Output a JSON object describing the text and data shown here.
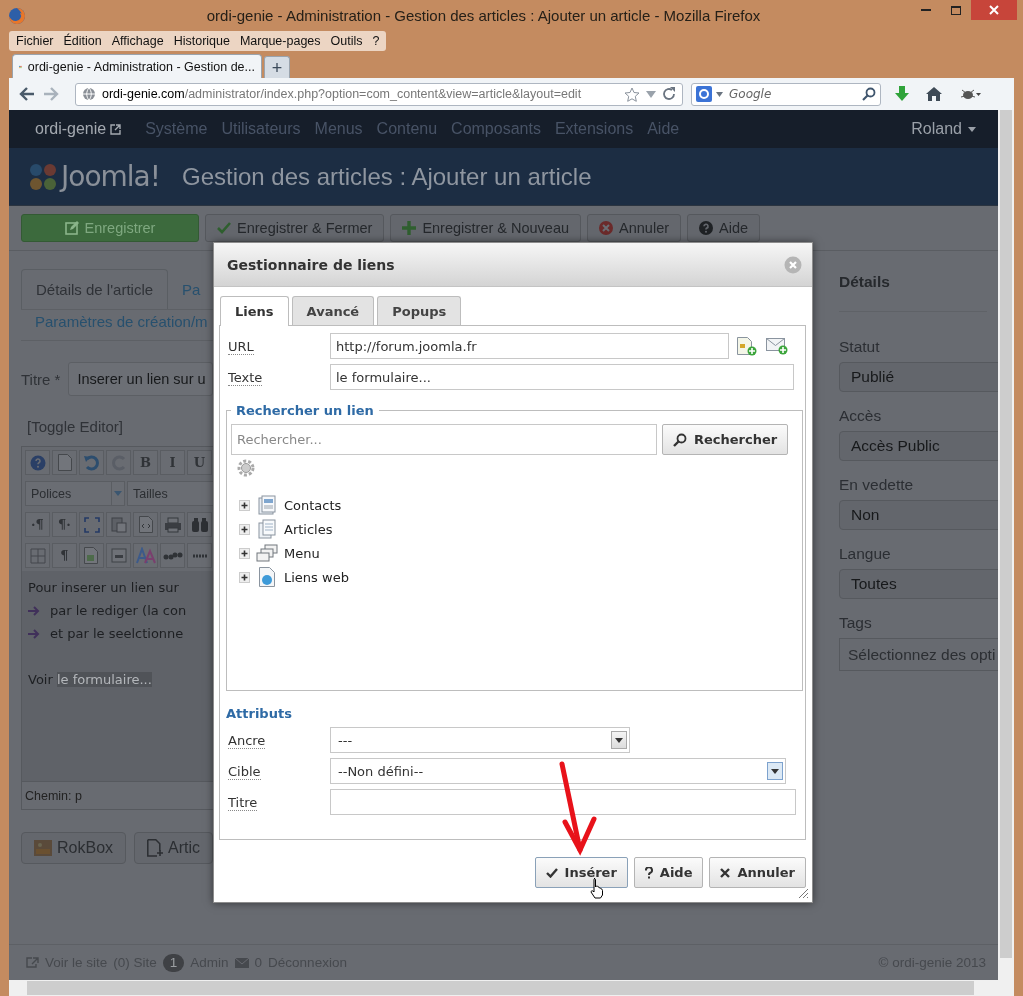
{
  "window": {
    "title": "ordi-genie - Administration - Gestion des articles : Ajouter un article - Mozilla Firefox"
  },
  "menu_bar": [
    "Fichier",
    "Édition",
    "Affichage",
    "Historique",
    "Marque-pages",
    "Outils",
    "?"
  ],
  "browser_tabs": [
    {
      "label": "ordi-genie - Administration - Gestion de...",
      "selected": true
    }
  ],
  "new_tab_button": "+",
  "address_bar": {
    "domain": "ordi-genie.com",
    "path": "/administrator/index.php?option=com_content&view=article&layout=edit"
  },
  "search_box": {
    "placeholder": "Google"
  },
  "admin_nav": {
    "site": "ordi-genie",
    "items": [
      "Système",
      "Utilisateurs",
      "Menus",
      "Contenu",
      "Composants",
      "Extensions",
      "Aide"
    ],
    "user": "Roland"
  },
  "header": {
    "logo_text": "Joomla!",
    "title": "Gestion des articles : Ajouter un article"
  },
  "toolbar": [
    {
      "label": "Enregistrer",
      "kind": "save"
    },
    {
      "label": "Enregistrer & Fermer",
      "kind": "save-close"
    },
    {
      "label": "Enregistrer & Nouveau",
      "kind": "save-new"
    },
    {
      "label": "Annuler",
      "kind": "cancel"
    },
    {
      "label": "Aide",
      "kind": "help"
    }
  ],
  "article_tabs": [
    {
      "label": "Détails de l'article",
      "selected": true
    },
    {
      "label": "Pa",
      "selected": false
    },
    {
      "label": "Paramètres de création/m",
      "selected": false
    }
  ],
  "title_field": {
    "label": "Titre *",
    "value": "Inserer un lien sur u"
  },
  "toggle_editor": "[Toggle Editor]",
  "editor": {
    "toolbar_rows": [
      [
        {
          "kind": "help"
        },
        {
          "kind": "document"
        },
        {
          "kind": "undo"
        },
        {
          "kind": "redo"
        },
        {
          "kind": "text",
          "label": "B"
        },
        {
          "kind": "text",
          "label": "I"
        },
        {
          "kind": "text",
          "label": "U"
        }
      ],
      [
        {
          "kind": "select",
          "label": "Polices"
        },
        {
          "kind": "select",
          "label": "Tailles"
        }
      ],
      [
        {
          "kind": "text",
          "label": "·¶"
        },
        {
          "kind": "text",
          "label": "¶·"
        },
        {
          "kind": "fullscreen"
        },
        {
          "kind": "paste"
        },
        {
          "kind": "code"
        },
        {
          "kind": "print"
        },
        {
          "kind": "binoculars"
        }
      ],
      [
        {
          "kind": "table"
        },
        {
          "kind": "text",
          "label": "¶"
        },
        {
          "kind": "image"
        },
        {
          "kind": "media"
        },
        {
          "kind": "font"
        },
        {
          "kind": "quote"
        },
        {
          "kind": "abbr"
        }
      ]
    ],
    "intro": "Pour inserer un lien sur",
    "bullets": [
      "par le rediger (la con",
      "et par le seelctionne"
    ],
    "link_prefix": "Voir",
    "selected_text": "le formulaire...",
    "path": "Chemin:  p"
  },
  "bottom_buttons": [
    {
      "label": "RokBox",
      "kind": "image"
    },
    {
      "label": "Artic",
      "kind": "article"
    }
  ],
  "details": {
    "title": "Détails",
    "fields": [
      {
        "label": "Statut",
        "value": "Publié"
      },
      {
        "label": "Accès",
        "value": "Accès Public"
      },
      {
        "label": "En vedette",
        "value": "Non"
      },
      {
        "label": "Langue",
        "value": "Toutes"
      },
      {
        "label": "Tags",
        "placeholder": "Sélectionnez des opti"
      }
    ]
  },
  "footer": {
    "items": [
      {
        "kind": "external",
        "label": "Voir le site"
      },
      {
        "kind": "text",
        "label": "(0) Site"
      },
      {
        "kind": "badge",
        "label": "1"
      },
      {
        "kind": "text",
        "label": "Admin"
      },
      {
        "kind": "mail",
        "label": "0"
      },
      {
        "kind": "text",
        "label": "Déconnexion"
      }
    ],
    "copyright": "© ordi-genie 2013"
  },
  "dialog": {
    "title": "Gestionnaire de liens",
    "tabs": [
      {
        "label": "Liens",
        "selected": true
      },
      {
        "label": "Avancé",
        "selected": false
      },
      {
        "label": "Popups",
        "selected": false
      }
    ],
    "url": {
      "label": "URL",
      "value": "http://forum.joomla.fr"
    },
    "text": {
      "label": "Texte",
      "value": "le formulaire..."
    },
    "search": {
      "legend": "Rechercher un lien",
      "placeholder": "Rechercher...",
      "button": "Rechercher"
    },
    "tree": [
      {
        "label": "Contacts",
        "kind": "contacts",
        "expanded": false
      },
      {
        "label": "Articles",
        "kind": "articles",
        "expanded": false
      },
      {
        "label": "Menu",
        "kind": "menu",
        "expanded": false
      },
      {
        "label": "Liens web",
        "kind": "weblinks",
        "expanded": false
      }
    ],
    "attributes": {
      "legend": "Attributs",
      "fields": [
        {
          "label": "Ancre",
          "kind": "select-short",
          "value": "---"
        },
        {
          "label": "Cible",
          "kind": "select",
          "value": "--Non défini--"
        },
        {
          "label": "Titre",
          "kind": "input"
        }
      ]
    },
    "buttons": [
      {
        "label": "Insérer",
        "kind": "insert"
      },
      {
        "label": "Aide",
        "kind": "help"
      },
      {
        "label": "Annuler",
        "kind": "cancel"
      }
    ]
  }
}
